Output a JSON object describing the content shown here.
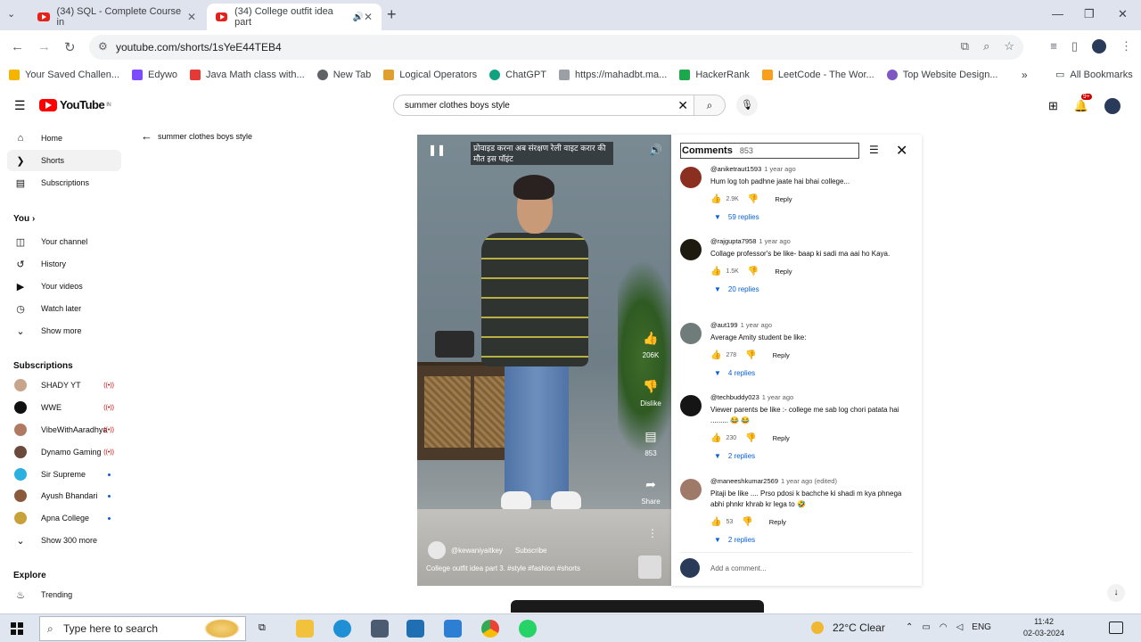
{
  "browser": {
    "tabs": [
      {
        "title": "(34) SQL - Complete Course in"
      },
      {
        "title": "(34) College outfit idea part"
      }
    ],
    "url": "youtube.com/shorts/1sYeE44TEB4"
  },
  "bookmarks": {
    "items": [
      {
        "label": "Your Saved Challen...",
        "color": "#f4b400"
      },
      {
        "label": "Edywo",
        "color": "#7c4dff"
      },
      {
        "label": "Java Math class with...",
        "color": "#e53935"
      },
      {
        "label": "New Tab",
        "color": "#5f6368"
      },
      {
        "label": "Logical Operators",
        "color": "#e0a030"
      },
      {
        "label": "ChatGPT",
        "color": "#10a37f"
      },
      {
        "label": "https://mahadbt.ma...",
        "color": "#9aa0a6"
      },
      {
        "label": "HackerRank",
        "color": "#1ba94c"
      },
      {
        "label": "LeetCode - The Wor...",
        "color": "#f89f1b"
      },
      {
        "label": "Top Website Design...",
        "color": "#7e57c2"
      }
    ],
    "all_label": "All Bookmarks"
  },
  "youtube": {
    "logo": "YouTube",
    "logo_country": "IN",
    "search_value": "summer clothes boys style",
    "notif_count": "9+"
  },
  "sidebar": {
    "main": [
      {
        "label": "Home",
        "icon": "home-icon"
      },
      {
        "label": "Shorts",
        "icon": "shorts-icon"
      },
      {
        "label": "Subscriptions",
        "icon": "subscriptions-icon"
      }
    ],
    "you_heading": "You",
    "you_items": [
      {
        "label": "Your channel",
        "icon": "channel-icon"
      },
      {
        "label": "History",
        "icon": "history-icon"
      },
      {
        "label": "Your videos",
        "icon": "videos-icon"
      },
      {
        "label": "Watch later",
        "icon": "clock-icon"
      },
      {
        "label": "Show more",
        "icon": "chevron-down-icon"
      }
    ],
    "subs_heading": "Subscriptions",
    "subscriptions": [
      {
        "label": "SHADY YT",
        "color": "#c7a58a",
        "status": "live"
      },
      {
        "label": "WWE",
        "color": "#111111",
        "status": "live"
      },
      {
        "label": "VibeWithAaradhya",
        "color": "#b07a62",
        "status": "live"
      },
      {
        "label": "Dynamo Gaming",
        "color": "#6a4a3a",
        "status": "live"
      },
      {
        "label": "Sir Supreme",
        "color": "#2cb0e0",
        "status": "new"
      },
      {
        "label": "Ayush Bhandari",
        "color": "#8b5a3c",
        "status": "new"
      },
      {
        "label": "Apna College",
        "color": "#c9a13a",
        "status": "new"
      }
    ],
    "show_more_subs": "Show 300 more",
    "explore_heading": "Explore",
    "explore_items": [
      {
        "label": "Trending",
        "icon": "trending-icon"
      }
    ]
  },
  "back_link": "summer clothes boys style",
  "short": {
    "overlay_text": "प्रोवाइड करना अब संरक्षण रेली वाइट करार की मौत इस पॉइंट",
    "likes": "206K",
    "dislike_label": "Dislike",
    "comments_count": "853",
    "share_label": "Share",
    "channel": "@kewaniyaitkey",
    "subscribe": "Subscribe",
    "title": "College outfit idea part 3. #style #fashion #shorts"
  },
  "comments": {
    "title": "Comments",
    "count": "853",
    "items": [
      {
        "author": "@aniketraut1593",
        "time": "1 year ago",
        "text": "Hum log toh padhne jaate hai bhai college...",
        "likes": "2.9K",
        "replies": "59 replies",
        "color": "#8b2f20"
      },
      {
        "author": "@rajgupta7958",
        "time": "1 year ago",
        "text": "Collage professor's be like- baap ki sadi ma aai ho Kaya.",
        "likes": "1.5K",
        "replies": "20 replies",
        "color": "#1f1a10"
      },
      {
        "author": "@aut199",
        "time": "1 year ago",
        "text": "Average Amity student be like:",
        "likes": "278",
        "replies": "4 replies",
        "color": "#6f7c7a"
      },
      {
        "author": "@techbuddy023",
        "time": "1 year ago",
        "text": "Viewer parents be like :- college me sab log chori patata  hai ......... 😂 😂",
        "likes": "230",
        "replies": "2 replies",
        "color": "#151515"
      },
      {
        "author": "@maneeshkumar2569",
        "time": "1 year ago (edited)",
        "text": "Pitaji be like .... Prso pdosi k bachche ki shadi m kya phnega abhi phnkr khrab kr lega to 🤣",
        "likes": "53",
        "replies": "2 replies",
        "color": "#a07a68"
      }
    ],
    "reply_label": "Reply",
    "add_placeholder": "Add a comment..."
  },
  "taskbar": {
    "search_placeholder": "Type here to search",
    "weather": "22°C  Clear",
    "lang": "ENG",
    "time": "11:42",
    "date": "02-03-2024"
  }
}
